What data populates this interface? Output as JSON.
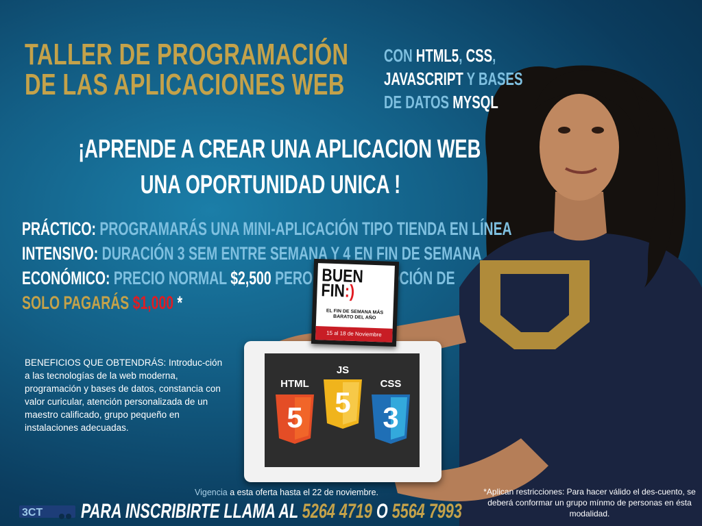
{
  "title": {
    "line1": "TALLER DE PROGRAMACIÓN",
    "line2": "DE LAS APLICACIONES WEB"
  },
  "tech": {
    "con": "CON ",
    "html5": "HTML5",
    "comma1": ", ",
    "css": "CSS",
    "comma2": ",",
    "javascript": "JAVASCRIPT",
    "y_bases": " Y BASES",
    "de_datos": "DE DATOS ",
    "mysql": "MYSQL"
  },
  "headline": {
    "line1": "¡APRENDE A CREAR UNA APLICACION WEB",
    "line2": "UNA OPORTUNIDAD UNICA !"
  },
  "features": [
    {
      "label": "PRÁCTICO:",
      "text": " PROGRAMARÁS UNA MINI-APLICACIÓN TIPO TIENDA EN LÍNEA"
    },
    {
      "label": "INTENSIVO:",
      "text": " DURACIÓN 3 SEM ENTRE SEMANA Y 4 EN FIN DE SEMANA"
    },
    {
      "label": "ECONÓMICO:",
      "text1": " PRECIO NORMAL ",
      "price": "$2,500",
      "text2": " PERO POR PROMOCIÓN DE"
    }
  ],
  "promo": {
    "text": "SOLO PAGARÁS ",
    "price": "$1,000",
    "star": " *"
  },
  "benefits": "BENEFICIOS QUE OBTENDRÁS: Introduc-ción a las tecnologías de la web moderna, programación y bases de datos, constancia con valor curicular, atención personalizada de un maestro calificado, grupo pequeño en instalaciones adecuadas.",
  "vigencia": {
    "label": "Vigencia",
    "text": " a esta oferta hasta el 22 de noviembre."
  },
  "cta": {
    "text": "PARA INSCRIBIRTE LLAMA AL ",
    "phone1": "5264 4719",
    "o": " O ",
    "phone2": "5564 7993"
  },
  "restrictions": "*Aplican restricciones: Para hacer válido el des-cuento, se deberá conformar un grupo mínmo de personas en ésta modalidad.",
  "logo": "3CT",
  "buen_fin": {
    "line1": "BUEN",
    "line2": "FIN",
    "smile": ":)",
    "tag": "EL FIN DE SEMANA MÁS BARATO DEL AÑO",
    "dates": "15 al 18 de Noviembre"
  },
  "tablet_badges": {
    "html": "HTML",
    "js": "JS",
    "css": "CSS",
    "html_num": "5",
    "js_num": "5",
    "css_num": "3"
  },
  "colors": {
    "gold": "#c4a24a",
    "light_blue": "#7fc0e0",
    "red": "#e11b22",
    "html_orange": "#e44d26",
    "js_yellow": "#f0b41c",
    "css_blue": "#1f6fb6"
  }
}
